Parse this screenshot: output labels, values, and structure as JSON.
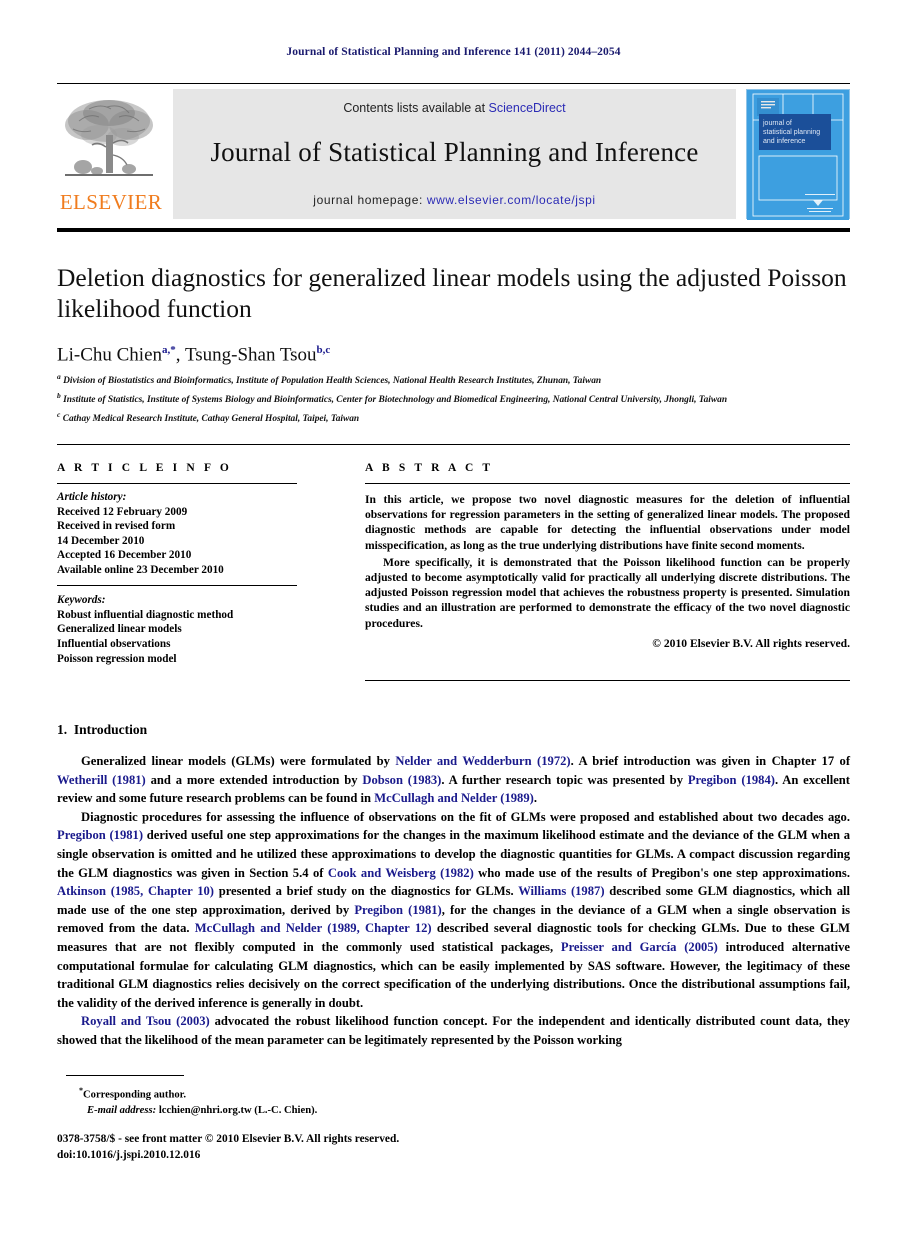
{
  "running_head": "Journal of Statistical Planning and Inference 141 (2011) 2044–2054",
  "masthead": {
    "contents_prefix": "Contents lists available at ",
    "sciencedirect": "ScienceDirect",
    "journal_title": "Journal of Statistical Planning and Inference",
    "homepage_prefix": "journal homepage: ",
    "homepage_url": "www.elsevier.com/locate/jspi",
    "publisher_wordmark": "ELSEVIER",
    "cover_title_line1": "journal of",
    "cover_title_line2": "statistical planning",
    "cover_title_line3": "and inference",
    "colors": {
      "link_blue": "#2b2bb5",
      "elsevier_orange": "#F07C1E",
      "cover_blue": "#3d9fe0",
      "cover_title_block": "#1b4f99",
      "panel_gray": "#e6e6e6"
    }
  },
  "article": {
    "title": "Deletion diagnostics for generalized linear models using the adjusted Poisson likelihood function",
    "authors_text": "Li-Chu Chien",
    "author1_sup": "a,*",
    "authors_sep": ", ",
    "author2_text": "Tsung-Shan Tsou",
    "author2_sup": "b,c",
    "affiliations": [
      {
        "marker": "a",
        "text": "Division of Biostatistics and Bioinformatics, Institute of Population Health Sciences, National Health Research Institutes, Zhunan, Taiwan"
      },
      {
        "marker": "b",
        "text": "Institute of Statistics, Institute of Systems Biology and Bioinformatics, Center for Biotechnology and Biomedical Engineering, National Central University, Jhongli, Taiwan"
      },
      {
        "marker": "c",
        "text": "Cathay Medical Research Institute, Cathay General Hospital, Taipei, Taiwan"
      }
    ]
  },
  "article_info": {
    "heading": "A R T I C L E   I N F O",
    "history_label": "Article history:",
    "history": [
      "Received 12 February 2009",
      "Received in revised form",
      "14 December 2010",
      "Accepted 16 December 2010",
      "Available online 23 December 2010"
    ],
    "keywords_label": "Keywords:",
    "keywords": [
      "Robust influential diagnostic method",
      "Generalized linear models",
      "Influential observations",
      "Poisson regression model"
    ]
  },
  "abstract": {
    "heading": "A B S T R A C T",
    "paragraphs": [
      "In this article, we propose two novel diagnostic measures for the deletion of influential observations for regression parameters in the setting of generalized linear models. The proposed diagnostic methods are capable for detecting the influential observations under model misspecification, as long as the true underlying distributions have finite second moments.",
      "More specifically, it is demonstrated that the Poisson likelihood function can be properly adjusted to become asymptotically valid for practically all underlying discrete distributions. The adjusted Poisson regression model that achieves the robustness property is presented. Simulation studies and an illustration are performed to demonstrate the efficacy of the two novel diagnostic procedures."
    ],
    "copyright": "© 2010 Elsevier B.V. All rights reserved."
  },
  "body": {
    "section_number": "1.",
    "section_title": "Introduction",
    "paragraphs": [
      [
        {
          "t": "Generalized linear models (GLMs) were formulated by ",
          "k": "n"
        },
        {
          "t": "Nelder and Wedderburn (1972)",
          "k": "c"
        },
        {
          "t": ". A brief introduction was given in Chapter 17 of ",
          "k": "n"
        },
        {
          "t": "Wetherill (1981)",
          "k": "c"
        },
        {
          "t": " and a more extended introduction by ",
          "k": "n"
        },
        {
          "t": "Dobson (1983)",
          "k": "c"
        },
        {
          "t": ". A further research topic was presented by ",
          "k": "n"
        },
        {
          "t": "Pregibon (1984)",
          "k": "c"
        },
        {
          "t": ". An excellent review and some future research problems can be found in ",
          "k": "n"
        },
        {
          "t": "McCullagh and Nelder (1989)",
          "k": "c"
        },
        {
          "t": ".",
          "k": "n"
        }
      ],
      [
        {
          "t": "Diagnostic procedures for assessing the influence of observations on the fit of GLMs were proposed and established about two decades ago. ",
          "k": "n"
        },
        {
          "t": "Pregibon (1981)",
          "k": "c"
        },
        {
          "t": " derived useful one step approximations for the changes in the maximum likelihood estimate and the deviance of the GLM when a single observation is omitted and he utilized these approximations to develop the diagnostic quantities for GLMs. A compact discussion regarding the GLM diagnostics was given in Section 5.4 of ",
          "k": "n"
        },
        {
          "t": "Cook and Weisberg (1982)",
          "k": "c"
        },
        {
          "t": " who made use of the results of Pregibon's one step approximations. ",
          "k": "n"
        },
        {
          "t": "Atkinson (1985, Chapter 10)",
          "k": "c"
        },
        {
          "t": " presented a brief study on the diagnostics for GLMs. ",
          "k": "n"
        },
        {
          "t": "Williams (1987)",
          "k": "c"
        },
        {
          "t": " described some GLM diagnostics, which all made use of the one step approximation, derived by ",
          "k": "n"
        },
        {
          "t": "Pregibon (1981)",
          "k": "c"
        },
        {
          "t": ", for the changes in the deviance of a GLM when a single observation is removed from the data. ",
          "k": "n"
        },
        {
          "t": "McCullagh and Nelder (1989, Chapter 12)",
          "k": "c"
        },
        {
          "t": " described several diagnostic tools for checking GLMs. Due to these GLM measures that are not flexibly computed in the commonly used statistical packages, ",
          "k": "n"
        },
        {
          "t": "Preisser and García (2005)",
          "k": "c"
        },
        {
          "t": " introduced alternative computational formulae for calculating GLM diagnostics, which can be easily implemented by SAS software. However, the legitimacy of these traditional GLM diagnostics relies decisively on the correct specification of the underlying distributions. Once the distributional assumptions fail, the validity of the derived inference is generally in doubt.",
          "k": "n"
        }
      ],
      [
        {
          "t": "Royall and Tsou (2003)",
          "k": "c"
        },
        {
          "t": " advocated the robust likelihood function concept. For the independent and identically distributed count data, they showed that the likelihood of the mean parameter can be legitimately represented by the Poisson working",
          "k": "n"
        }
      ]
    ]
  },
  "footnotes": {
    "corresponding_marker": "*",
    "corresponding_text": "Corresponding author.",
    "email_label": "E-mail address:",
    "email_value": "lcchien@nhri.org.tw (L.-C. Chien).",
    "issn_line": "0378-3758/$ - see front matter © 2010 Elsevier B.V. All rights reserved.",
    "doi_line": "doi:10.1016/j.jspi.2010.12.016"
  }
}
